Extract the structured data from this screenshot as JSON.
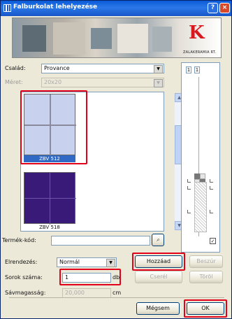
{
  "window": {
    "title": "Falburkolat lehelyezése",
    "help_label": "?",
    "close_label": "×"
  },
  "banner": {
    "logo_text": "ZALAKERAMIA RT.",
    "logo_letter": "K"
  },
  "family": {
    "label": "Család:",
    "value": "Provance"
  },
  "size": {
    "label": "Méret:",
    "value": "20x20"
  },
  "tiles": [
    {
      "name": "ZBV 512",
      "selected": true,
      "color": "#c8d2ee"
    },
    {
      "name": "ZBV 518",
      "selected": false,
      "color": "#3a1a78"
    }
  ],
  "product_code": {
    "label": "Termék-kód:",
    "value": ""
  },
  "layout": {
    "label": "Elrendezés:",
    "value": "Normál"
  },
  "rows": {
    "label": "Sorok száma:",
    "value": "1",
    "unit": "db"
  },
  "band_height": {
    "label": "Sávmagasság:",
    "value": "20,000",
    "unit": "cm"
  },
  "buttons": {
    "add": "Hozzáad",
    "insert": "Beszúr",
    "replace": "Cserél",
    "delete": "Töröl",
    "cancel": "Mégsem",
    "ok": "OK"
  },
  "side_panel": {
    "spin_a": "1",
    "spin_b": "1",
    "checkbox": "✓"
  },
  "colors": {
    "highlight": "#e2001a",
    "selection": "#316ac5",
    "titlebar": "#0a5bd8"
  }
}
